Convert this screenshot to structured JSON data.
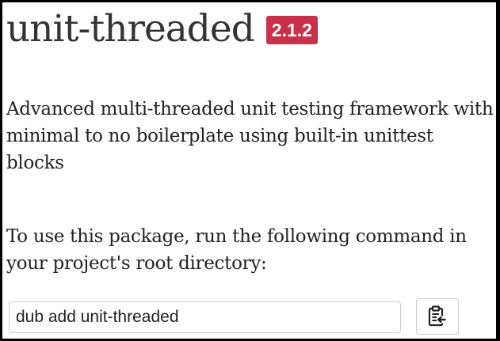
{
  "package": {
    "name": "unit-threaded",
    "version": "2.1.2",
    "description": "Advanced multi-threaded unit testing framework with minimal to no boilerplate using built-in unittest blocks"
  },
  "install": {
    "instructions": "To use this package, run the following command in your project's root directory:",
    "command": "dub add unit-threaded",
    "copy_icon": "clipboard-icon"
  },
  "colors": {
    "badge": "#c9304a",
    "title": "#333333",
    "text": "#222222"
  }
}
